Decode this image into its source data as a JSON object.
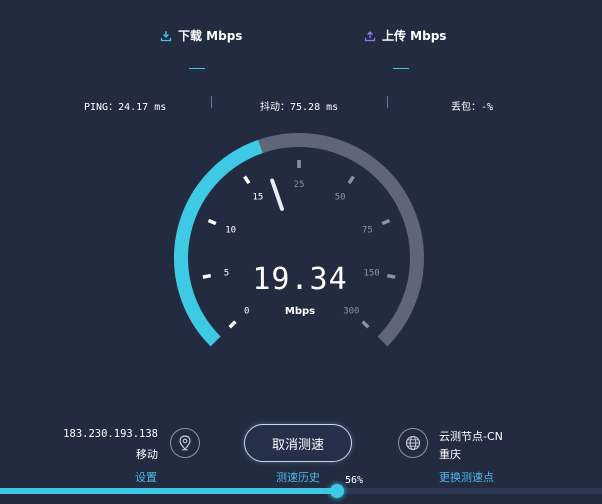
{
  "tabs": [
    {
      "label": "下载 Mbps",
      "icon": "download-icon",
      "color": "#3ec9e4"
    },
    {
      "label": "上传 Mbps",
      "icon": "upload-icon",
      "color": "#8b7cf6"
    }
  ],
  "stats": {
    "ping": "PING：24.17 ms",
    "jitter": "抖动：75.28 ms",
    "loss": "丢包：-%"
  },
  "gauge": {
    "value": 19.34,
    "value_text": "19.34",
    "unit": "Mbps",
    "ticks": [
      "0",
      "5",
      "10",
      "15",
      "25",
      "50",
      "75",
      "150",
      "300"
    ],
    "fill_color": "#3ec9e4",
    "track_color": "#5f6679"
  },
  "client": {
    "ip": "183.230.193.138",
    "isp": "移动",
    "settings_label": "设置"
  },
  "actions": {
    "cancel_label": "取消测速",
    "history_label": "测速历史"
  },
  "node": {
    "name": "云测节点-CN",
    "city": "重庆",
    "change_label": "更换测速点"
  },
  "progress": {
    "percent": 56,
    "text": "56%"
  }
}
